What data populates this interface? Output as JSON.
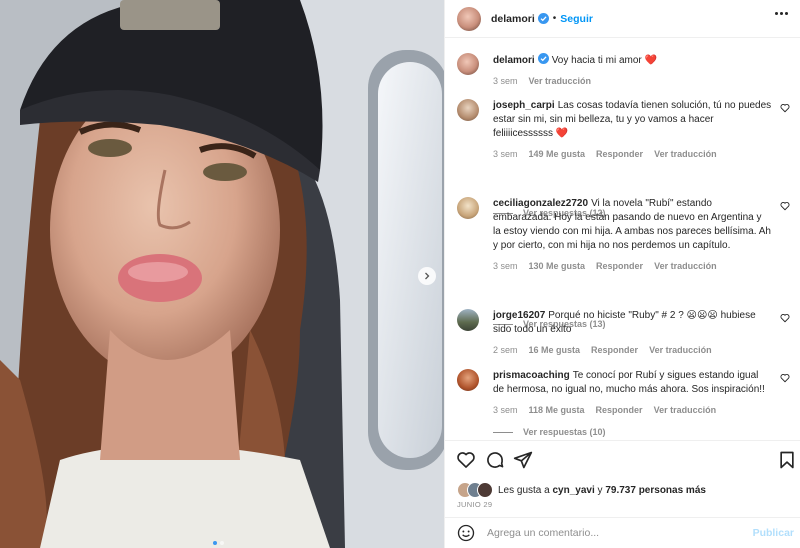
{
  "post": {
    "username": "delamori",
    "follow_label": "Seguir",
    "caption": "Voy hacia ti mi amor",
    "caption_emoji": "❤️",
    "caption_time": "3 sem",
    "caption_translate": "Ver traducción"
  },
  "comments": [
    {
      "user": "joseph_carpi",
      "text": "Las cosas todavía tienen solución, tú no puedes estar sin mi, sin mi belleza, tu y yo vamos a hacer feliiiicessssss ❤️",
      "time": "3 sem",
      "likes": "149 Me gusta",
      "reply": "Responder",
      "translate": "Ver traducción",
      "replies": "Ver respuestas (12)"
    },
    {
      "user": "ceciliagonzalez2720",
      "text": "Vi la novela \"Rubí\" estando embarazada. Hoy la están pasando de nuevo en Argentina y la estoy viendo con mi hija. A ambas nos pareces bellísima. Ah y por cierto, con mi hija no nos perdemos un capítulo.",
      "time": "3 sem",
      "likes": "130 Me gusta",
      "reply": "Responder",
      "translate": "Ver traducción",
      "replies": "Ver respuestas (13)"
    },
    {
      "user": "jorge16207",
      "text": "Porqué no hiciste \"Ruby\" # 2 ? 😦😦😦 hubiese sido todo un éxito",
      "time": "2 sem",
      "likes": "16 Me gusta",
      "reply": "Responder",
      "translate": "Ver traducción",
      "replies": ""
    },
    {
      "user": "prismacoaching",
      "text": "Te conocí por Rubí y sigues estando igual de hermosa, no igual no, mucho más ahora. Sos inspiración!!",
      "time": "3 sem",
      "likes": "118 Me gusta",
      "reply": "Responder",
      "translate": "Ver traducción",
      "replies": "Ver respuestas (10)"
    }
  ],
  "likes_line": {
    "prefix": "Les gusta a",
    "user": "cyn_yavi",
    "middle": "y",
    "count": "79.737 personas más"
  },
  "date": "JUNIO 29",
  "add_comment": {
    "placeholder": "Agrega un comentario...",
    "post_label": "Publicar"
  },
  "carousel": {
    "total": 2,
    "active": 0
  },
  "colors": {
    "accent": "#0095f6",
    "verified": "#3897f0",
    "heart": "#ed4956",
    "muted": "#8e8e8e"
  },
  "icons": [
    "verified-icon",
    "more-icon",
    "heart-icon",
    "comment-icon",
    "share-icon",
    "bookmark-icon",
    "emoji-icon",
    "chevron-right-icon"
  ]
}
